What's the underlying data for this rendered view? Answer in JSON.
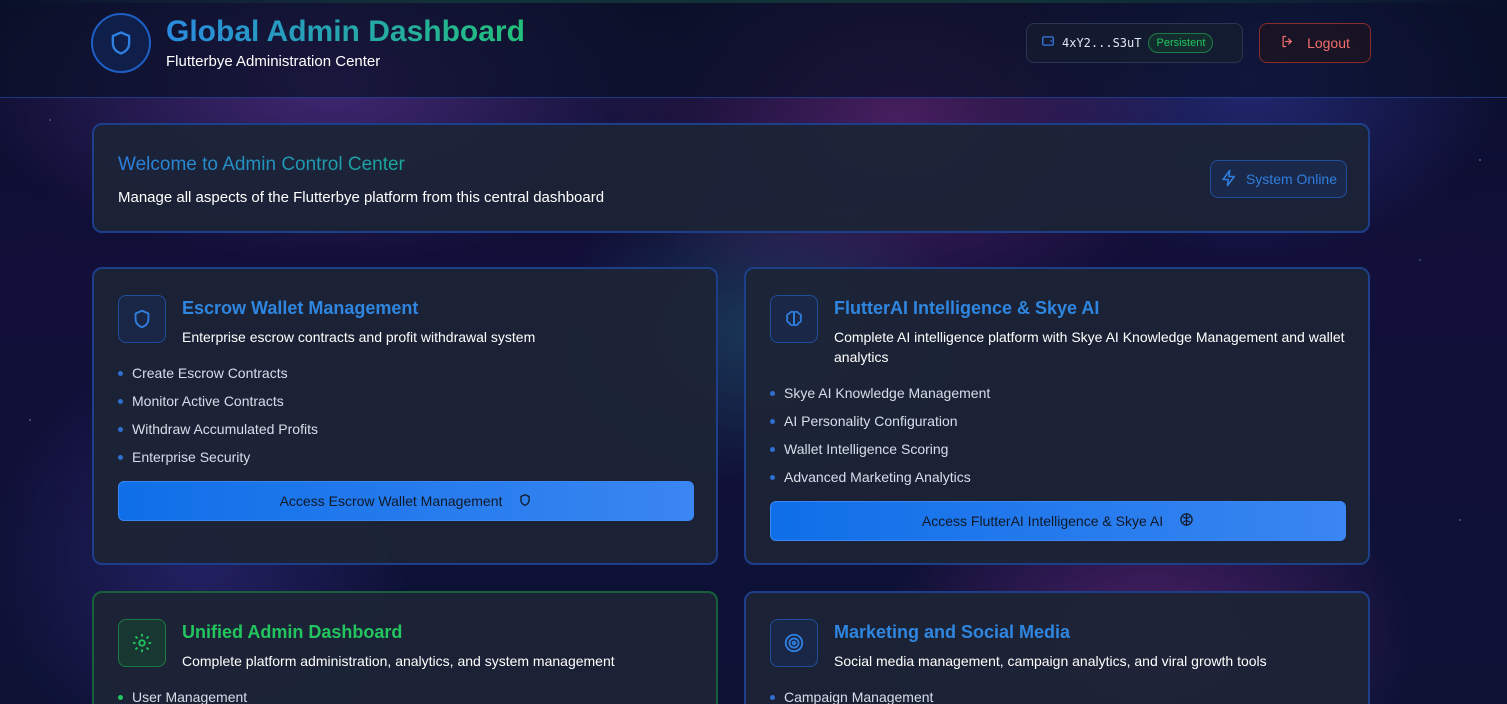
{
  "header": {
    "title": "Global Admin Dashboard",
    "subtitle": "Flutterbye Administration Center",
    "wallet_address": "4xY2...S3uT",
    "wallet_badge": "Persistent",
    "logout_label": "Logout"
  },
  "welcome": {
    "title": "Welcome to Admin Control Center",
    "description": "Manage all aspects of the Flutterbye platform from this central dashboard",
    "status_label": "System Online"
  },
  "cards": [
    {
      "icon": "shield-icon",
      "title": "Escrow Wallet Management",
      "description": "Enterprise escrow contracts and profit withdrawal system",
      "features": [
        "Create Escrow Contracts",
        "Monitor Active Contracts",
        "Withdraw Accumulated Profits",
        "Enterprise Security"
      ],
      "action_label": "Access Escrow Wallet Management"
    },
    {
      "icon": "brain-icon",
      "title": "FlutterAI Intelligence & Skye AI",
      "description": "Complete AI intelligence platform with Skye AI Knowledge Management and wallet analytics",
      "features": [
        "Skye AI Knowledge Management",
        "AI Personality Configuration",
        "Wallet Intelligence Scoring",
        "Advanced Marketing Analytics"
      ],
      "action_label": "Access FlutterAI Intelligence & Skye AI"
    },
    {
      "icon": "gear-icon",
      "title": "Unified Admin Dashboard",
      "description": "Complete platform administration, analytics, and system management",
      "features": [
        "User Management"
      ]
    },
    {
      "icon": "target-icon",
      "title": "Marketing and Social Media",
      "description": "Social media management, campaign analytics, and viral growth tools",
      "features": [
        "Campaign Management"
      ]
    }
  ],
  "colors": {
    "accent_blue": "#2f86e0",
    "accent_green": "#22c55e",
    "logout_red": "#f26d6d"
  }
}
